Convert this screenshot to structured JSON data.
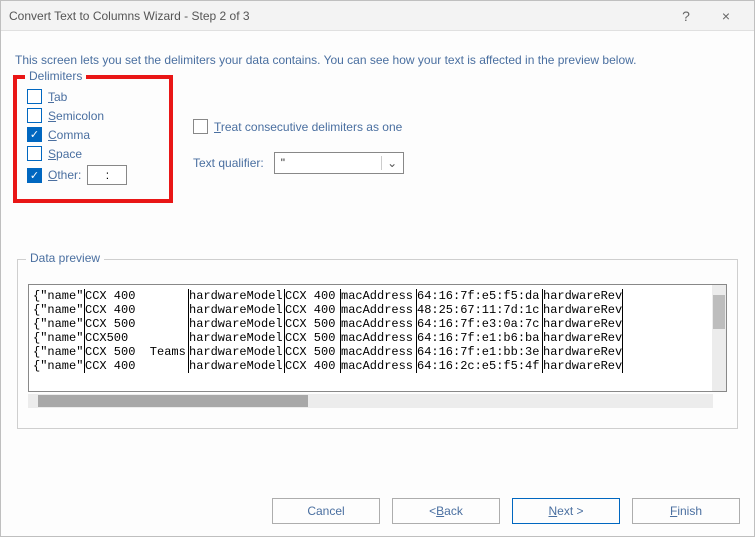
{
  "titlebar": {
    "title": "Convert Text to Columns Wizard - Step 2 of 3",
    "help": "?",
    "close": "×"
  },
  "description": "This screen lets you set the delimiters your data contains.  You can see how your text is affected in the preview below.",
  "delimiters": {
    "legend": "Delimiters",
    "tab": {
      "label": "Tab",
      "ul": "T",
      "rest": "ab",
      "checked": false
    },
    "semicolon": {
      "label": "Semicolon",
      "ul": "S",
      "rest": "emicolon",
      "checked": false
    },
    "comma": {
      "label": "Comma",
      "ul": "C",
      "rest": "omma",
      "checked": true
    },
    "space": {
      "label": "Space",
      "ul": "S",
      "rest": "pace",
      "checked": false
    },
    "other": {
      "label": "Other:",
      "ul": "O",
      "rest": "ther:",
      "checked": true,
      "value": ":"
    }
  },
  "treat_consecutive": {
    "ul": "T",
    "rest": "reat consecutive delimiters as one",
    "checked": false
  },
  "qualifier": {
    "label": "Text qualifier:",
    "value": "\""
  },
  "preview": {
    "legend": "Data preview",
    "rows": [
      {
        "c0": "{\"name\"",
        "c1": "CCX 400",
        "c2": "hardwareModel",
        "c3": "CCX 400",
        "c4": "macAddress",
        "c5": "64:16:7f:e5:f5:da",
        "c6": "hardwareRev"
      },
      {
        "c0": "{\"name\"",
        "c1": "CCX 400",
        "c2": "hardwareModel",
        "c3": "CCX 400",
        "c4": "macAddress",
        "c5": "48:25:67:11:7d:1c",
        "c6": "hardwareRev"
      },
      {
        "c0": "{\"name\"",
        "c1": "CCX 500",
        "c2": "hardwareModel",
        "c3": "CCX 500",
        "c4": "macAddress",
        "c5": "64:16:7f:e3:0a:7c",
        "c6": "hardwareRev"
      },
      {
        "c0": "{\"name\"",
        "c1": "CCX500",
        "c2": "hardwareModel",
        "c3": "CCX 500",
        "c4": "macAddress",
        "c5": "64:16:7f:e1:b6:ba",
        "c6": "hardwareRev"
      },
      {
        "c0": "{\"name\"",
        "c1": "CCX 500  Teams",
        "c2": "hardwareModel",
        "c3": "CCX 500",
        "c4": "macAddress",
        "c5": "64:16:7f:e1:bb:3e",
        "c6": "hardwareRev"
      },
      {
        "c0": "{\"name\"",
        "c1": "CCX 400",
        "c2": "hardwareModel",
        "c3": "CCX 400",
        "c4": "macAddress",
        "c5": "64:16:2c:e5:f5:4f",
        "c6": "hardwareRev"
      }
    ]
  },
  "buttons": {
    "cancel": "Cancel",
    "back_ul": "B",
    "back_rest": "ack",
    "back_prefix": "< ",
    "next_ul": "N",
    "next_rest": "ext >",
    "finish_ul": "F",
    "finish_rest": "inish"
  }
}
